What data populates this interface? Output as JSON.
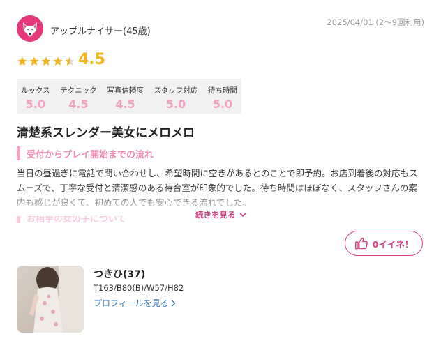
{
  "reviewer": {
    "name": "アップルナイサー(45歳)",
    "avatar_icon": "fox-mask-icon",
    "avatar_color": "#e5387a"
  },
  "date": "2025/04/01 (2〜9回利用)",
  "rating": {
    "value": "4.5",
    "stars_filled_fraction": 0.9,
    "star_color": "#f2b51d"
  },
  "scores": [
    {
      "label": "ルックス",
      "value": "5.0"
    },
    {
      "label": "テクニック",
      "value": "4.5"
    },
    {
      "label": "写真信頼度",
      "value": "4.5"
    },
    {
      "label": "スタッフ対応",
      "value": "5.0"
    },
    {
      "label": "待ち時間",
      "value": "5.0"
    }
  ],
  "review": {
    "title": "清楚系スレンダー美女にメロメロ",
    "section1_heading": "受付からプレイ開始までの流れ",
    "section1_text": "当日の昼過ぎに電話で問い合わせし、希望時間に空きがあるとのことで即予約。お店到着後の対応もスムーズで、丁寧な受付と清潔感のある待合室が印象的でした。待ち時間はほぼなく、スタッフさんの案内も感じが良くて、初めての人でも安心できる流れでした。",
    "section2_heading": "お相手の女の子について",
    "more_label": "続きを見る",
    "accent_color": "#f5a2bf"
  },
  "like_button": {
    "label": "0イイネ！",
    "color": "#e03e85"
  },
  "cast": {
    "name": "つきひ(37)",
    "size": "T163/B80(B)/W57/H82",
    "profile_link": "プロフィールを見る"
  }
}
